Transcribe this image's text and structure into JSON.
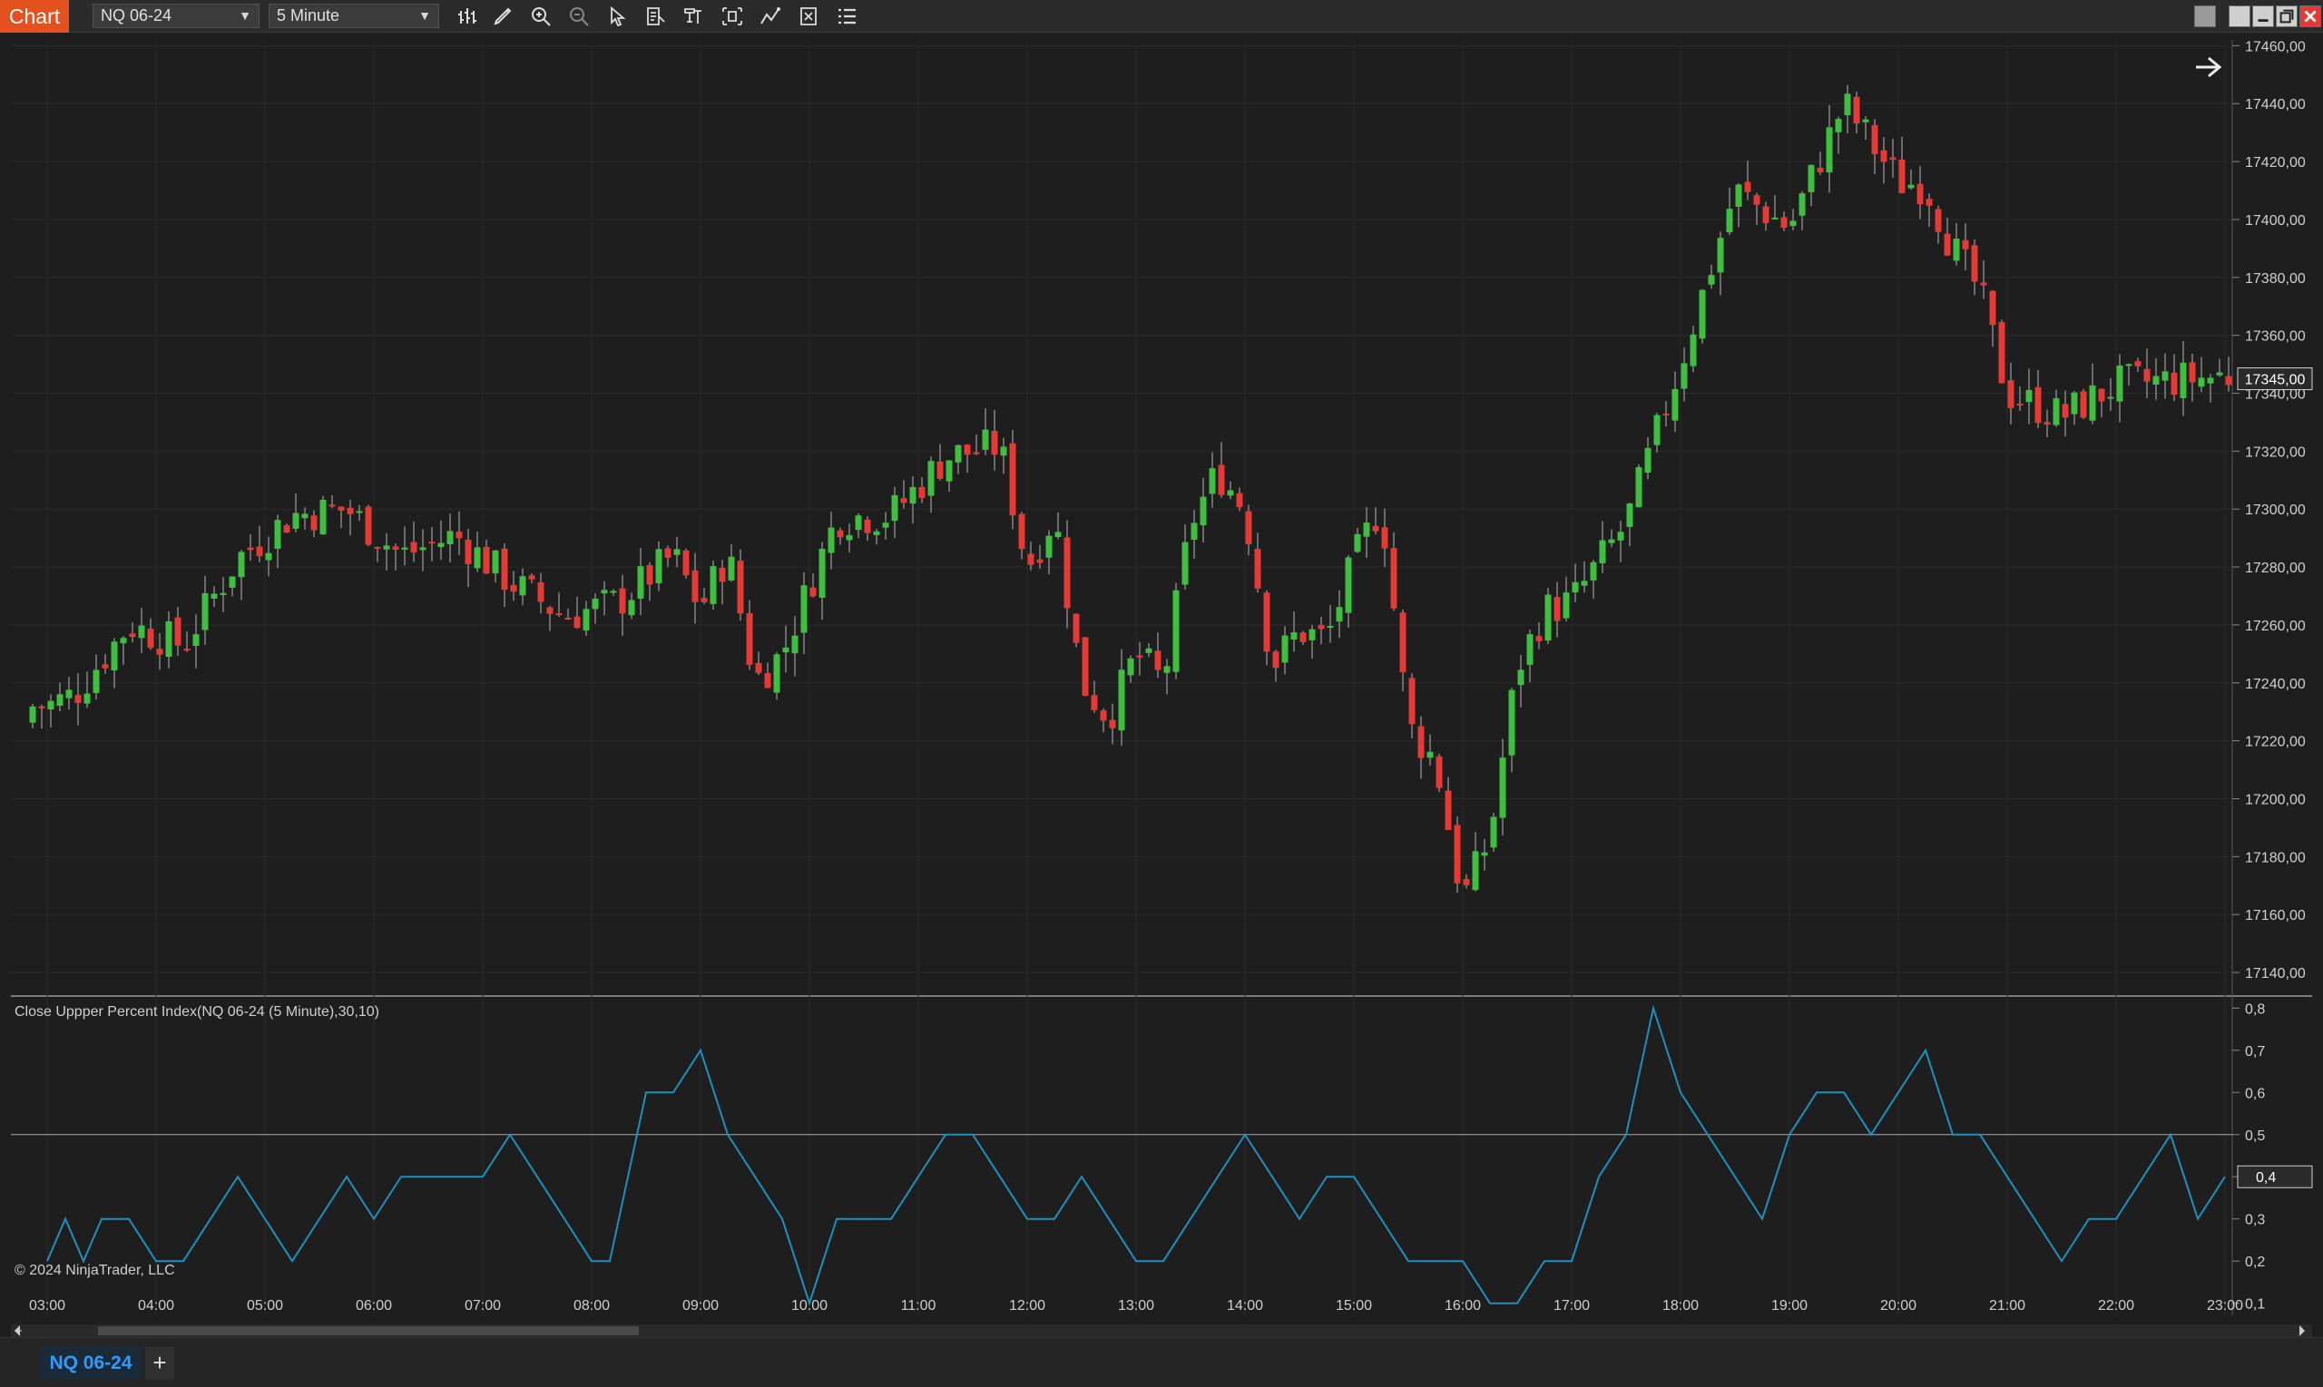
{
  "toolbar": {
    "chart_tab": "Chart",
    "instrument": "NQ 06-24",
    "interval": "5 Minute"
  },
  "indicator": {
    "label": "Close Uppper Percent Index(NQ 06-24 (5 Minute),30,10)"
  },
  "copyright": "© 2024 NinjaTrader, LLC",
  "bottom_tabs": {
    "instrument": "NQ 06-24",
    "add": "+"
  },
  "colors": {
    "up": "#3fbf3f",
    "down": "#e53935",
    "wick": "#b8b8b8",
    "indicator": "#1e8fbf",
    "accent": "#e2511e",
    "background": "#1e1e1e"
  },
  "chart_data": [
    {
      "type": "candlestick",
      "x": [
        "03:00",
        "04:00",
        "05:00",
        "06:00",
        "07:00",
        "08:00",
        "09:00",
        "10:00",
        "11:00",
        "12:00",
        "13:00",
        "14:00",
        "15:00",
        "16:00",
        "17:00",
        "18:00",
        "19:00",
        "20:00",
        "21:00",
        "22:00",
        "23:00"
      ],
      "y_ticks": [
        "17460,00",
        "17440,00",
        "17420,00",
        "17400,00",
        "17380,00",
        "17360,00",
        "17340,00",
        "17320,00",
        "17300,00",
        "17280,00",
        "17260,00",
        "17240,00",
        "17220,00",
        "17200,00",
        "17180,00",
        "17160,00",
        "17140,00"
      ],
      "ylim": [
        17135,
        17462
      ],
      "last_price": "17345,00",
      "series": [
        {
          "values": [
            17232,
            17236,
            17260,
            17253,
            17283,
            17298,
            17300,
            17284,
            17291,
            17275,
            17263,
            17268,
            17284,
            17266,
            17285,
            17241,
            17250,
            17297,
            17298,
            17318,
            17322,
            17280,
            17298,
            17240,
            17228,
            17250,
            17240,
            17295,
            17313,
            17300,
            17246,
            17258,
            17255,
            17282,
            17302,
            17225,
            17213,
            17165,
            17187,
            17245,
            17265,
            17268,
            17295,
            17350,
            17410,
            17397,
            17440,
            17413,
            17412,
            17390,
            17375,
            17340,
            17332,
            17343,
            17346
          ],
          "times": [
            "03:00",
            "03:15",
            "03:45",
            "04:15",
            "04:45",
            "05:15",
            "05:45",
            "06:15",
            "06:45",
            "07:15",
            "07:45",
            "08:15",
            "08:45",
            "09:00",
            "09:15",
            "09:30",
            "09:45",
            "10:15",
            "10:45",
            "11:15",
            "11:45",
            "12:00",
            "12:15",
            "12:30",
            "12:45",
            "13:00",
            "13:15",
            "13:30",
            "13:45",
            "14:00",
            "14:15",
            "14:30",
            "14:45",
            "15:00",
            "15:15",
            "15:30",
            "15:45",
            "16:00",
            "16:15",
            "16:30",
            "16:45",
            "17:00",
            "17:30",
            "18:00",
            "18:30",
            "19:00",
            "19:30",
            "20:00",
            "20:15",
            "20:30",
            "20:45",
            "21:00",
            "21:30",
            "22:00",
            "23:00"
          ]
        }
      ]
    },
    {
      "type": "line",
      "y_ticks": [
        "0,8",
        "0,7",
        "0,6",
        "0,5",
        "0,4",
        "0,3",
        "0,2",
        "0,1"
      ],
      "ylim": [
        0.08,
        0.82
      ],
      "reference_line": 0.5,
      "last_value": "0,4",
      "series": [
        {
          "x": [
            "03:00",
            "03:10",
            "03:20",
            "03:30",
            "03:45",
            "04:00",
            "04:15",
            "04:30",
            "04:45",
            "05:00",
            "05:15",
            "05:30",
            "05:45",
            "06:00",
            "06:15",
            "06:30",
            "06:45",
            "07:00",
            "07:15",
            "07:30",
            "07:45",
            "08:00",
            "08:10",
            "08:20",
            "08:30",
            "08:45",
            "09:00",
            "09:15",
            "09:30",
            "09:45",
            "10:00",
            "10:15",
            "10:30",
            "10:45",
            "11:00",
            "11:15",
            "11:30",
            "11:45",
            "12:00",
            "12:15",
            "12:30",
            "12:45",
            "13:00",
            "13:15",
            "13:30",
            "13:45",
            "14:00",
            "14:15",
            "14:30",
            "14:45",
            "15:00",
            "15:15",
            "15:30",
            "15:45",
            "16:00",
            "16:15",
            "16:30",
            "16:45",
            "17:00",
            "17:15",
            "17:30",
            "17:45",
            "18:00",
            "18:15",
            "18:30",
            "18:45",
            "19:00",
            "19:15",
            "19:30",
            "19:45",
            "20:00",
            "20:15",
            "20:30",
            "20:45",
            "21:00",
            "21:15",
            "21:30",
            "21:45",
            "22:00",
            "22:15",
            "22:30",
            "22:45",
            "23:00"
          ],
          "values": [
            0.2,
            0.3,
            0.2,
            0.3,
            0.3,
            0.2,
            0.2,
            0.3,
            0.4,
            0.3,
            0.2,
            0.3,
            0.4,
            0.3,
            0.4,
            0.4,
            0.4,
            0.4,
            0.5,
            0.4,
            0.3,
            0.2,
            0.2,
            0.4,
            0.6,
            0.6,
            0.7,
            0.5,
            0.4,
            0.3,
            0.1,
            0.3,
            0.3,
            0.3,
            0.4,
            0.5,
            0.5,
            0.4,
            0.3,
            0.3,
            0.4,
            0.3,
            0.2,
            0.2,
            0.3,
            0.4,
            0.5,
            0.4,
            0.3,
            0.4,
            0.4,
            0.3,
            0.2,
            0.2,
            0.2,
            0.1,
            0.1,
            0.2,
            0.2,
            0.4,
            0.5,
            0.8,
            0.6,
            0.5,
            0.4,
            0.3,
            0.5,
            0.6,
            0.6,
            0.5,
            0.6,
            0.7,
            0.5,
            0.5,
            0.4,
            0.3,
            0.2,
            0.3,
            0.3,
            0.4,
            0.5,
            0.3,
            0.4
          ]
        }
      ]
    }
  ]
}
